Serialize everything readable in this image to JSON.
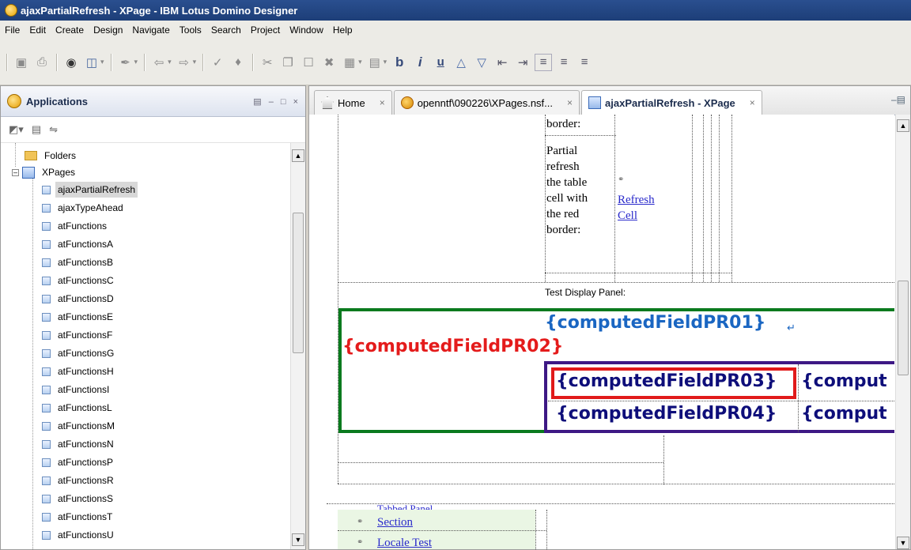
{
  "window": {
    "title": "ajaxPartialRefresh - XPage - IBM Lotus Domino Designer"
  },
  "menu": [
    "File",
    "Edit",
    "Create",
    "Design",
    "Navigate",
    "Tools",
    "Search",
    "Project",
    "Window",
    "Help"
  ],
  "toolbar": {
    "bold": "b",
    "italic": "i",
    "underline": "u"
  },
  "applications": {
    "title": "Applications",
    "tree": {
      "folders": "Folders",
      "xpages": "XPages",
      "items": [
        "ajaxPartialRefresh",
        "ajaxTypeAhead",
        "atFunctions",
        "atFunctionsA",
        "atFunctionsB",
        "atFunctionsC",
        "atFunctionsD",
        "atFunctionsE",
        "atFunctionsF",
        "atFunctionsG",
        "atFunctionsH",
        "atFunctionsI",
        "atFunctionsL",
        "atFunctionsM",
        "atFunctionsN",
        "atFunctionsP",
        "atFunctionsR",
        "atFunctionsS",
        "atFunctionsT",
        "atFunctionsU"
      ]
    }
  },
  "tabs": {
    "home": "Home",
    "nsf": "openntf\\090226\\XPages.nsf...",
    "xpage": "ajaxPartialRefresh - XPage",
    "close": "×"
  },
  "canvas": {
    "border_label_top": "border:",
    "cell_text": [
      "Partial",
      "refresh",
      "the table",
      "cell with",
      "the red",
      "border:"
    ],
    "refresh_link": [
      "Refresh",
      "Cell"
    ],
    "test_display_label": "Test Display Panel:",
    "computed_fields": {
      "pr01": "{computedFieldPR01}",
      "pr02": "{computedFieldPR02}",
      "pr03": "{computedFieldPR03}",
      "pr04": "{computedFieldPR04}",
      "trunc_a": "{comput",
      "trunc_b": "{comput"
    },
    "tabbed_panel": "Tabbed Panel",
    "section_link": "Section",
    "locale_link": "Locale Test"
  },
  "colors": {
    "computed_blue": "#1a66c2",
    "computed_red": "#e41b1b",
    "computed_navy": "#0e0e7a",
    "panel_green": "#0a7a1e",
    "panel_purple": "#3d1884",
    "cell_red": "#e11a1a"
  }
}
